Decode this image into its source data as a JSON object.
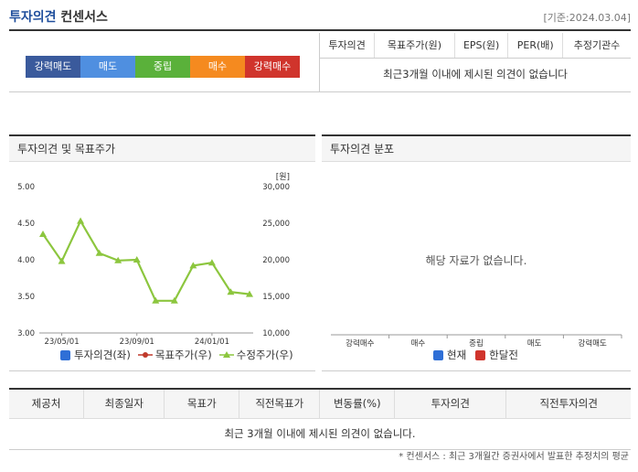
{
  "header": {
    "title_accent": "투자의견",
    "title_rest": "컨센서스",
    "date": "[기준:2024.03.04]"
  },
  "opinion_scale": [
    {
      "label": "강력매도",
      "color": "#3a5a9c"
    },
    {
      "label": "매도",
      "color": "#4f8fe0"
    },
    {
      "label": "중립",
      "color": "#5ab13a"
    },
    {
      "label": "매수",
      "color": "#f58a1f"
    },
    {
      "label": "강력매수",
      "color": "#d0342c"
    }
  ],
  "consensus_table": {
    "headers": [
      "투자의견",
      "목표주가(원)",
      "EPS(원)",
      "PER(배)",
      "추정기관수"
    ],
    "empty_message": "최근3개월 이내에 제시된 의견이 없습니다"
  },
  "left_panel": {
    "title": "투자의견 및 목표주가",
    "legend": [
      {
        "label": "투자의견(좌)",
        "color": "#2f6fd6"
      },
      {
        "label": "목표주가(우)",
        "color": "#c0392b"
      },
      {
        "label": "수정주가(우)",
        "color": "#8cc63e"
      }
    ]
  },
  "right_panel": {
    "title": "투자의견 분포",
    "no_data": "해당 자료가 없습니다.",
    "categories": [
      "강력매수",
      "매수",
      "중립",
      "매도",
      "강력매도"
    ],
    "legend": [
      {
        "label": "현재",
        "color": "#2f6fd6"
      },
      {
        "label": "한달전",
        "color": "#d0342c"
      }
    ]
  },
  "chart_data": {
    "type": "line",
    "x": [
      "23/04",
      "23/05",
      "23/06",
      "23/07",
      "23/08",
      "23/09",
      "23/10",
      "23/11",
      "23/12",
      "24/01",
      "24/02",
      "24/03"
    ],
    "x_tick_labels": [
      "23/05/01",
      "23/09/01",
      "24/01/01"
    ],
    "y_left": {
      "ticks": [
        "3.00",
        "3.50",
        "4.00",
        "4.50",
        "5.00"
      ],
      "range": [
        3.0,
        5.0
      ]
    },
    "y_right": {
      "unit": "[원]",
      "ticks": [
        "10,000",
        "15,000",
        "20,000",
        "25,000",
        "30,000"
      ],
      "range": [
        10000,
        30000
      ]
    },
    "series": [
      {
        "name": "수정주가",
        "axis": "right",
        "color": "#8cc63e",
        "values": [
          23500,
          19800,
          25300,
          20900,
          19900,
          20000,
          14400,
          14400,
          19200,
          19600,
          15600,
          15300
        ]
      }
    ],
    "grid": false
  },
  "bottom_table": {
    "headers": [
      "제공처",
      "최종일자",
      "목표가",
      "직전목표가",
      "변동률(%)",
      "투자의견",
      "직전투자의견"
    ],
    "empty_message": "최근 3개월 이내에 제시된 의견이 없습니다."
  },
  "footnote": "* 컨센서스 : 최근 3개월간 증권사에서 발표한 추정치의 평균"
}
